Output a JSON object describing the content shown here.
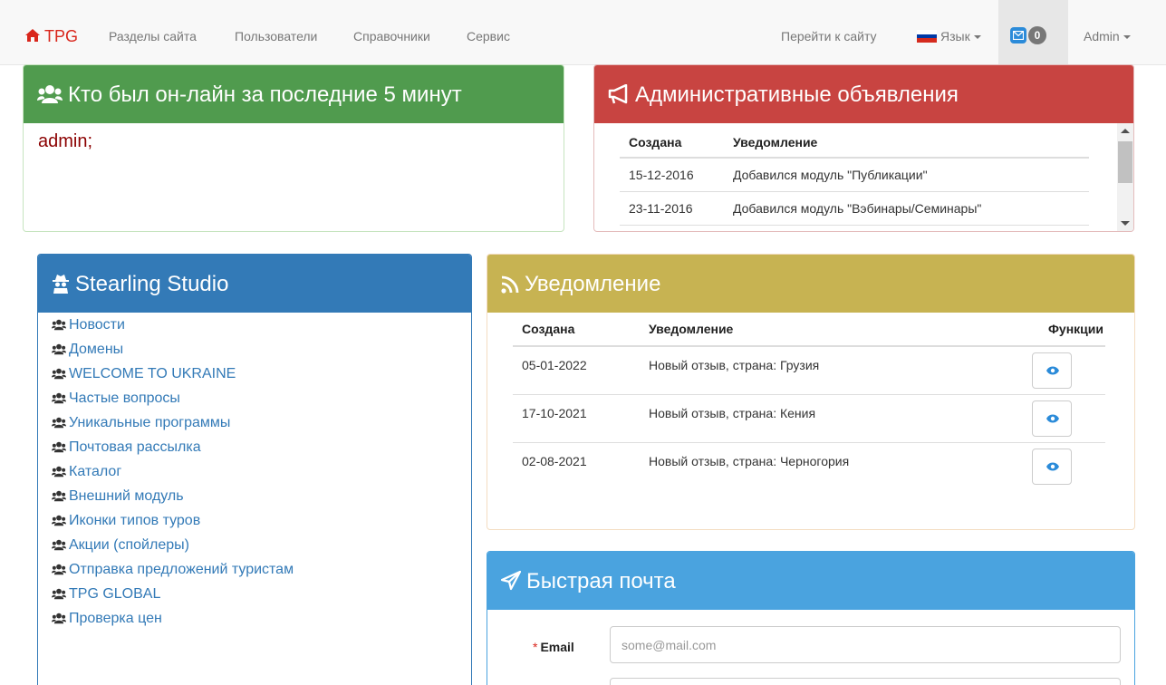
{
  "navbar": {
    "brand": "TPG",
    "items": [
      {
        "label": "Разделы сайта"
      },
      {
        "label": "Пользователи"
      },
      {
        "label": "Справочники"
      },
      {
        "label": "Сервис"
      }
    ],
    "go_to_site": "Перейти к сайту",
    "language": "Язык",
    "mail_count": "0",
    "user": "Admin",
    "brand_color": "#d9261c"
  },
  "online_panel": {
    "title": "Кто был он-лайн за последние 5 минут",
    "users": "admin;",
    "color": "#509b4e"
  },
  "admin_panel": {
    "title": "Административные объявления",
    "columns": [
      "Создана",
      "Уведомление"
    ],
    "rows": [
      {
        "date": "15-12-2016",
        "text": "Добавился модуль \"Публикации\""
      },
      {
        "date": "23-11-2016",
        "text": "Добавился модуль \"Вэбинары/Семинары\""
      }
    ],
    "color": "#c84441"
  },
  "studio_panel": {
    "title": "Stearling Studio",
    "items": [
      "Новости",
      "Домены",
      "WELCOME TO UKRAINE",
      "Частые вопросы",
      "Уникальные программы",
      "Почтовая рассылка",
      "Каталог",
      "Внешний модуль",
      "Иконки типов туров",
      "Акции (спойлеры)",
      "Отправка предложений туристам",
      "TPG GLOBAL",
      "Проверка цен"
    ],
    "color": "#337ab7"
  },
  "notification_panel": {
    "title": "Уведомление",
    "columns": [
      "Создана",
      "Уведомление",
      "Функции"
    ],
    "rows": [
      {
        "date": "05-01-2022",
        "text": "Новый отзыв, страна: Грузия"
      },
      {
        "date": "17-10-2021",
        "text": "Новый отзыв, страна: Кения"
      },
      {
        "date": "02-08-2021",
        "text": "Новый отзыв, страна: Черногория"
      }
    ],
    "color": "#c7b352"
  },
  "quick_mail_panel": {
    "title": "Быстрая почта",
    "email_label": "Email",
    "email_required_mark": "*",
    "email_placeholder": "some@mail.com",
    "color": "#4aa3df"
  }
}
